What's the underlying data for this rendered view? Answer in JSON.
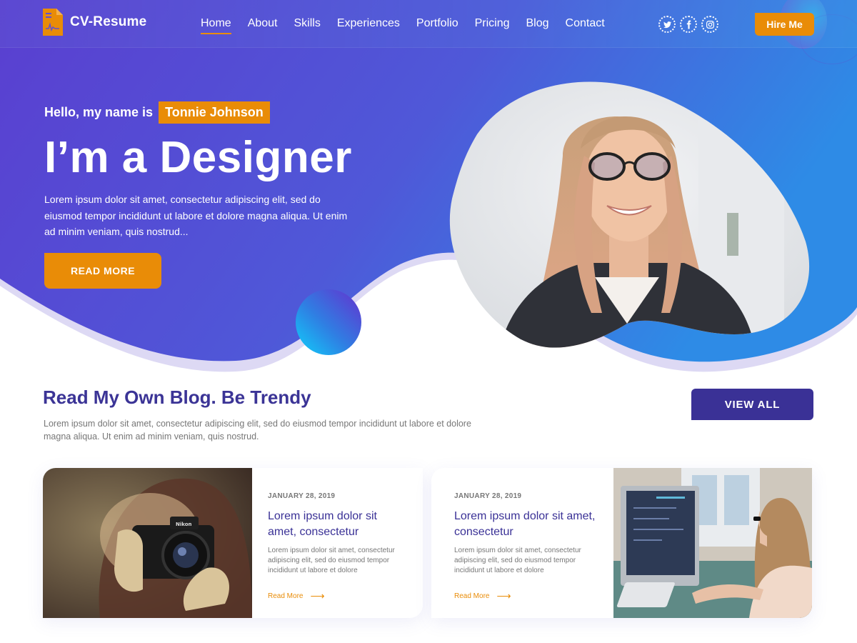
{
  "brand": {
    "name": "CV-Resume",
    "icon": "resume-document-icon"
  },
  "nav": {
    "items": [
      {
        "label": "Home",
        "active": true
      },
      {
        "label": "About",
        "active": false
      },
      {
        "label": "Skills",
        "active": false
      },
      {
        "label": "Experiences",
        "active": false
      },
      {
        "label": "Portfolio",
        "active": false
      },
      {
        "label": "Pricing",
        "active": false
      },
      {
        "label": "Blog",
        "active": false
      },
      {
        "label": "Contact",
        "active": false
      }
    ]
  },
  "socials": [
    {
      "name": "twitter",
      "icon": "twitter-icon"
    },
    {
      "name": "facebook",
      "icon": "facebook-icon"
    },
    {
      "name": "instagram",
      "icon": "instagram-icon"
    }
  ],
  "header": {
    "hire_label": "Hire Me"
  },
  "hero": {
    "greeting": "Hello, my name is",
    "name": "Tonnie Johnson",
    "headline": "I’m a Designer",
    "description": "Lorem ipsum dolor sit amet, consectetur adipiscing elit, sed do eiusmod tempor incididunt ut labore et dolore magna aliqua. Ut enim ad minim veniam, quis nostrud...",
    "cta_label": "READ MORE",
    "portrait_alt": "Smiling woman with glasses"
  },
  "blog": {
    "title": "Read My Own Blog. Be Trendy",
    "description": "Lorem ipsum dolor sit amet, consectetur adipiscing elit, sed do eiusmod tempor incididunt ut labore et dolore magna aliqua. Ut enim ad minim veniam, quis nostrud.",
    "view_all_label": "VIEW ALL",
    "posts": [
      {
        "date": "JANUARY 28, 2019",
        "title": "Lorem ipsum dolor sit amet, consectetur",
        "excerpt": "Lorem ipsum dolor sit amet, consectetur adipiscing elit, sed do eiusmod tempor incididunt ut labore et dolore",
        "link_label": "Read More",
        "image_alt": "Woman holding Nikon camera"
      },
      {
        "date": "JANUARY 28, 2019",
        "title": "Lorem ipsum dolor sit amet, consectetur",
        "excerpt": "Lorem ipsum dolor sit amet, consectetur adipiscing elit, sed do eiusmod tempor incididunt ut labore et dolore",
        "link_label": "Read More",
        "image_alt": "Woman coding at desktop computer"
      }
    ]
  },
  "colors": {
    "accent": "#e98c07",
    "primary": "#3a3196",
    "hero_start": "#5a3fd0",
    "hero_end": "#2f8ae6"
  }
}
